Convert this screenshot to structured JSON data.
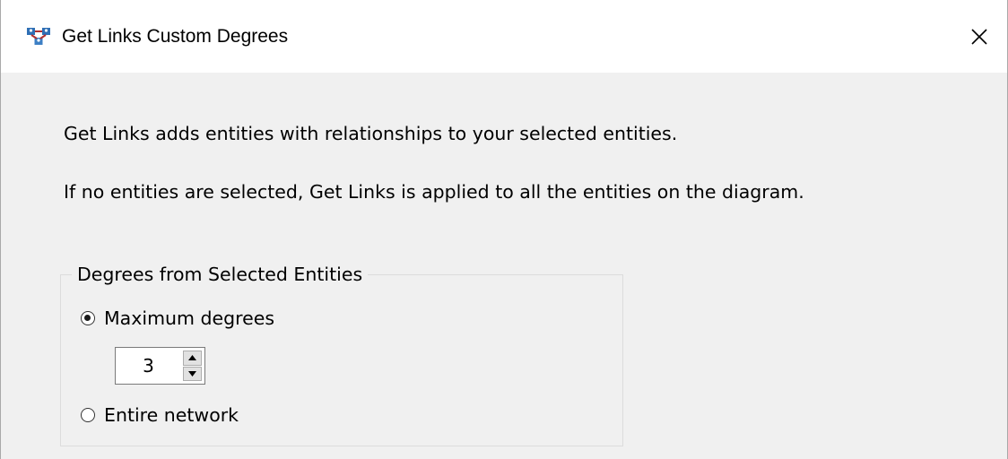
{
  "window": {
    "title": "Get Links Custom Degrees",
    "app_icon": "network-entities-icon",
    "close_icon": "close-icon"
  },
  "intro": {
    "line1": "Get Links adds entities with relationships to your selected entities.",
    "line2": "If no entities are selected, Get Links is applied to all the entities on the diagram."
  },
  "degrees_group": {
    "legend": "Degrees from Selected Entities",
    "options": [
      {
        "label": "Maximum degrees",
        "selected": true
      },
      {
        "label": "Entire network",
        "selected": false
      }
    ],
    "max_degrees_value": "3",
    "spinner_up_icon": "arrow-up-icon",
    "spinner_down_icon": "arrow-down-icon"
  },
  "colors": {
    "title_bar": "#ffffff",
    "dialog_background": "#f0f0f0",
    "group_border": "#dcdcdc",
    "icon_blue": "#2f6fb5"
  }
}
